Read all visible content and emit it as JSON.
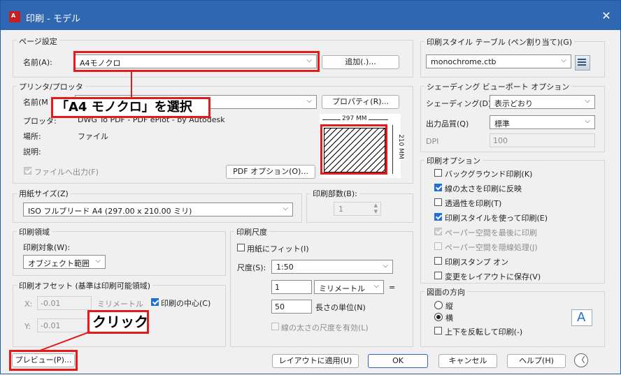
{
  "window": {
    "title": "印刷 - モデル",
    "close": "✕",
    "logo_text": "A"
  },
  "page_setup": {
    "group_label": "ページ設定",
    "name_label": "名前(A):",
    "name_value": "A4モノクロ",
    "add_button": "追加(.)..."
  },
  "printer": {
    "group_label": "プリンタ/プロッタ",
    "name_label": "名前(M",
    "properties_button": "プロパティ(R)...",
    "plotter_label": "プロッタ:",
    "plotter_value": "DWG To PDF - PDF ePlot - by Autodesk",
    "location_label": "場所:",
    "location_value": "ファイル",
    "description_label": "説明:",
    "print_to_file": "ファイルへ出力(F)",
    "pdf_options_button": "PDF オプション(O)...",
    "preview_width": "297 MM",
    "preview_height": "210 MM"
  },
  "paper_size": {
    "group_label": "用紙サイズ(Z)",
    "value": "ISO フルブリード A4 (297.00 x 210.00 ミリ)"
  },
  "copies": {
    "group_label": "印刷部数(B):",
    "value": "1"
  },
  "plot_area": {
    "group_label": "印刷領域",
    "what_label": "印刷対象(W):",
    "what_value": "オブジェクト範囲"
  },
  "plot_offset": {
    "group_label": "印刷オフセット (基準は印刷可能領域)",
    "x_label": "X:",
    "x_value": "-0.01",
    "x_unit": "ミリメートル",
    "y_label": "Y:",
    "y_value": "-0.01",
    "center_label": "印刷の中心(C)"
  },
  "plot_scale": {
    "group_label": "印刷尺度",
    "fit_label": "用紙にフィット(I)",
    "scale_label": "尺度(S):",
    "scale_value": "1:50",
    "num_value": "1",
    "unit_value": "ミリメートル",
    "equals": "=",
    "units_value": "50",
    "units_label": "長さの単位(N)",
    "lineweights_label": "線の太さの尺度を有効(L)"
  },
  "plot_style_table": {
    "group_label": "印刷スタイル テーブル (ペン割り当て)(G)",
    "value": "monochrome.ctb"
  },
  "shaded": {
    "group_label": "シェーディング ビューポート オプション",
    "shade_label": "シェーディング(D)",
    "shade_value": "表示どおり",
    "quality_label": "出力品質(Q)",
    "quality_value": "標準",
    "dpi_label": "DPI",
    "dpi_value": "100"
  },
  "plot_options": {
    "group_label": "印刷オプション",
    "items": [
      {
        "label": "バックグラウンド印刷(K)"
      },
      {
        "label": "線の太さを印刷に反映"
      },
      {
        "label": "透過性を印刷(T)"
      },
      {
        "label": "印刷スタイルを使って印刷(E)"
      },
      {
        "label": "ペーパー空間を最後に印刷"
      },
      {
        "label": "ペーパー空間を隠線処理(J)"
      },
      {
        "label": "印刷スタンプ オン"
      },
      {
        "label": "変更をレイアウトに保存(V)"
      }
    ]
  },
  "orientation": {
    "group_label": "図面の方向",
    "portrait": "縦",
    "landscape": "横",
    "upside_down": "上下を反転して印刷(-)",
    "icon_letter": "A"
  },
  "footer": {
    "preview": "プレビュー(P)...",
    "apply": "レイアウトに適用(U)",
    "ok": "OK",
    "cancel": "キャンセル",
    "help": "ヘルプ(H)",
    "collapse": "〈"
  },
  "annotations": {
    "select_callout": "「A4 モノクロ」を選択",
    "click_callout": "クリック"
  },
  "colors": {
    "titlebar": "#2f67b2",
    "annotation_red": "#e21b1b",
    "check_blue": "#1f6fd6"
  }
}
